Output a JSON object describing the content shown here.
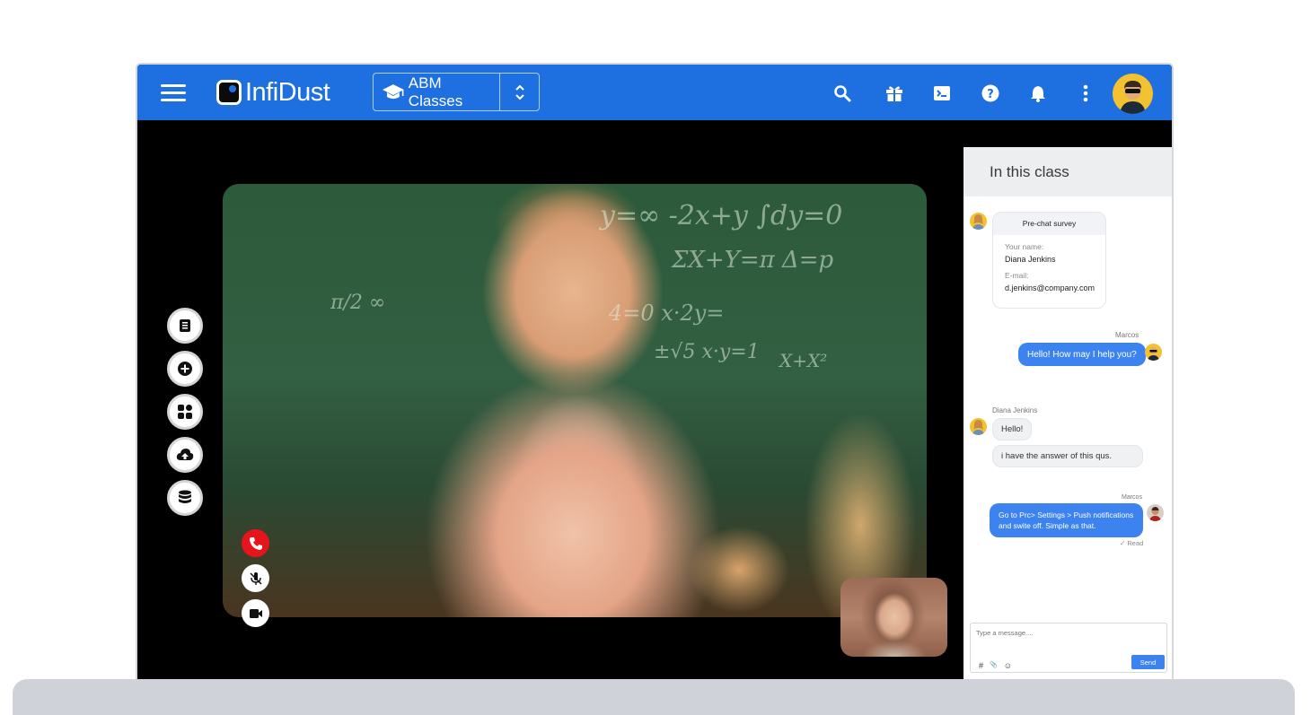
{
  "app": {
    "name": "InfiDust"
  },
  "header": {
    "class_selector": {
      "selected": "ABM Classes"
    },
    "icons": [
      "menu-icon",
      "search-icon",
      "gift-icon",
      "terminal-icon",
      "help-icon",
      "bell-icon",
      "more-vert-icon",
      "avatar"
    ]
  },
  "left_toolbar": {
    "icons": [
      "document-icon",
      "plus-circle-icon",
      "apps-icon",
      "cloud-upload-icon",
      "database-icon"
    ]
  },
  "call_controls": {
    "icons": [
      "end-call-icon",
      "mic-off-icon",
      "video-camera-icon"
    ],
    "colors": {
      "end_call": "#e8141c"
    }
  },
  "chat": {
    "title": "In this class",
    "survey": {
      "title": "Pre-chat survey",
      "name_label": "Your name:",
      "name_value": "Diana Jenkins",
      "email_label": "E-mail:",
      "email_value": "d.jenkins@company.com"
    },
    "messages": [
      {
        "sender": "Marcos",
        "text": "Hello! How may I help you?"
      },
      {
        "sender": "Diana Jenkins",
        "text": "Hello!"
      },
      {
        "sender": "",
        "text": "i have the answer of this qus."
      },
      {
        "sender": "Marcos",
        "text": "Go to Prc> Settings > Push notifications and swite off. Simple as that."
      }
    ],
    "read_status": "✓ Read",
    "composer": {
      "placeholder": "Type a message....",
      "tools": [
        "#",
        "📎",
        "☺"
      ],
      "send_label": "Send"
    }
  },
  "colors": {
    "brand": "#1e6fe0",
    "bubble": "#3c83f0",
    "avatar_bg": "#f2c230"
  }
}
